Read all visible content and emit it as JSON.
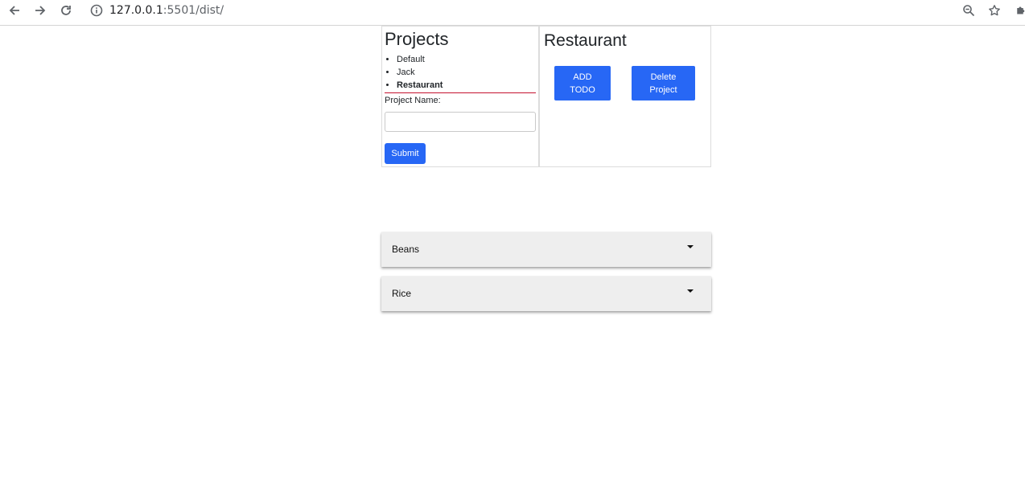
{
  "browser": {
    "url_host": "127.0.0.1",
    "url_path": ":5501/dist/"
  },
  "sidebar": {
    "title": "Projects",
    "projects": [
      {
        "label": "Default",
        "active": false
      },
      {
        "label": "Jack",
        "active": false
      },
      {
        "label": "Restaurant",
        "active": true
      }
    ],
    "project_name_label": "Project Name:",
    "project_name_value": "",
    "submit_label": "Submit"
  },
  "detail": {
    "title": "Restaurant",
    "add_todo_label": "ADD TODO",
    "delete_label": "Delete Project"
  },
  "todos": [
    {
      "title": "Beans"
    },
    {
      "title": "Rice"
    }
  ],
  "colors": {
    "accent": "#2767f5",
    "divider": "#c4122f",
    "card_bg": "#eeeeee"
  }
}
